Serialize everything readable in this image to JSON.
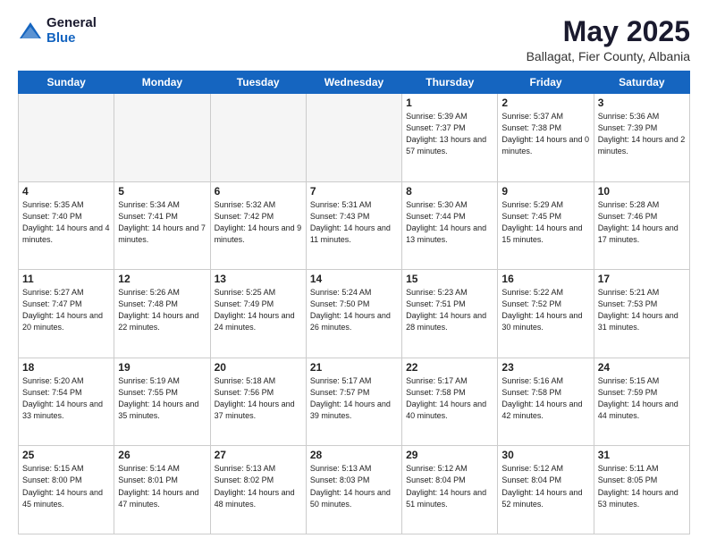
{
  "logo": {
    "general": "General",
    "blue": "Blue"
  },
  "header": {
    "month_year": "May 2025",
    "location": "Ballagat, Fier County, Albania"
  },
  "weekdays": [
    "Sunday",
    "Monday",
    "Tuesday",
    "Wednesday",
    "Thursday",
    "Friday",
    "Saturday"
  ],
  "weeks": [
    [
      {
        "day": "",
        "info": ""
      },
      {
        "day": "",
        "info": ""
      },
      {
        "day": "",
        "info": ""
      },
      {
        "day": "",
        "info": ""
      },
      {
        "day": "1",
        "info": "Sunrise: 5:39 AM\nSunset: 7:37 PM\nDaylight: 13 hours\nand 57 minutes."
      },
      {
        "day": "2",
        "info": "Sunrise: 5:37 AM\nSunset: 7:38 PM\nDaylight: 14 hours\nand 0 minutes."
      },
      {
        "day": "3",
        "info": "Sunrise: 5:36 AM\nSunset: 7:39 PM\nDaylight: 14 hours\nand 2 minutes."
      }
    ],
    [
      {
        "day": "4",
        "info": "Sunrise: 5:35 AM\nSunset: 7:40 PM\nDaylight: 14 hours\nand 4 minutes."
      },
      {
        "day": "5",
        "info": "Sunrise: 5:34 AM\nSunset: 7:41 PM\nDaylight: 14 hours\nand 7 minutes."
      },
      {
        "day": "6",
        "info": "Sunrise: 5:32 AM\nSunset: 7:42 PM\nDaylight: 14 hours\nand 9 minutes."
      },
      {
        "day": "7",
        "info": "Sunrise: 5:31 AM\nSunset: 7:43 PM\nDaylight: 14 hours\nand 11 minutes."
      },
      {
        "day": "8",
        "info": "Sunrise: 5:30 AM\nSunset: 7:44 PM\nDaylight: 14 hours\nand 13 minutes."
      },
      {
        "day": "9",
        "info": "Sunrise: 5:29 AM\nSunset: 7:45 PM\nDaylight: 14 hours\nand 15 minutes."
      },
      {
        "day": "10",
        "info": "Sunrise: 5:28 AM\nSunset: 7:46 PM\nDaylight: 14 hours\nand 17 minutes."
      }
    ],
    [
      {
        "day": "11",
        "info": "Sunrise: 5:27 AM\nSunset: 7:47 PM\nDaylight: 14 hours\nand 20 minutes."
      },
      {
        "day": "12",
        "info": "Sunrise: 5:26 AM\nSunset: 7:48 PM\nDaylight: 14 hours\nand 22 minutes."
      },
      {
        "day": "13",
        "info": "Sunrise: 5:25 AM\nSunset: 7:49 PM\nDaylight: 14 hours\nand 24 minutes."
      },
      {
        "day": "14",
        "info": "Sunrise: 5:24 AM\nSunset: 7:50 PM\nDaylight: 14 hours\nand 26 minutes."
      },
      {
        "day": "15",
        "info": "Sunrise: 5:23 AM\nSunset: 7:51 PM\nDaylight: 14 hours\nand 28 minutes."
      },
      {
        "day": "16",
        "info": "Sunrise: 5:22 AM\nSunset: 7:52 PM\nDaylight: 14 hours\nand 30 minutes."
      },
      {
        "day": "17",
        "info": "Sunrise: 5:21 AM\nSunset: 7:53 PM\nDaylight: 14 hours\nand 31 minutes."
      }
    ],
    [
      {
        "day": "18",
        "info": "Sunrise: 5:20 AM\nSunset: 7:54 PM\nDaylight: 14 hours\nand 33 minutes."
      },
      {
        "day": "19",
        "info": "Sunrise: 5:19 AM\nSunset: 7:55 PM\nDaylight: 14 hours\nand 35 minutes."
      },
      {
        "day": "20",
        "info": "Sunrise: 5:18 AM\nSunset: 7:56 PM\nDaylight: 14 hours\nand 37 minutes."
      },
      {
        "day": "21",
        "info": "Sunrise: 5:17 AM\nSunset: 7:57 PM\nDaylight: 14 hours\nand 39 minutes."
      },
      {
        "day": "22",
        "info": "Sunrise: 5:17 AM\nSunset: 7:58 PM\nDaylight: 14 hours\nand 40 minutes."
      },
      {
        "day": "23",
        "info": "Sunrise: 5:16 AM\nSunset: 7:58 PM\nDaylight: 14 hours\nand 42 minutes."
      },
      {
        "day": "24",
        "info": "Sunrise: 5:15 AM\nSunset: 7:59 PM\nDaylight: 14 hours\nand 44 minutes."
      }
    ],
    [
      {
        "day": "25",
        "info": "Sunrise: 5:15 AM\nSunset: 8:00 PM\nDaylight: 14 hours\nand 45 minutes."
      },
      {
        "day": "26",
        "info": "Sunrise: 5:14 AM\nSunset: 8:01 PM\nDaylight: 14 hours\nand 47 minutes."
      },
      {
        "day": "27",
        "info": "Sunrise: 5:13 AM\nSunset: 8:02 PM\nDaylight: 14 hours\nand 48 minutes."
      },
      {
        "day": "28",
        "info": "Sunrise: 5:13 AM\nSunset: 8:03 PM\nDaylight: 14 hours\nand 50 minutes."
      },
      {
        "day": "29",
        "info": "Sunrise: 5:12 AM\nSunset: 8:04 PM\nDaylight: 14 hours\nand 51 minutes."
      },
      {
        "day": "30",
        "info": "Sunrise: 5:12 AM\nSunset: 8:04 PM\nDaylight: 14 hours\nand 52 minutes."
      },
      {
        "day": "31",
        "info": "Sunrise: 5:11 AM\nSunset: 8:05 PM\nDaylight: 14 hours\nand 53 minutes."
      }
    ]
  ]
}
